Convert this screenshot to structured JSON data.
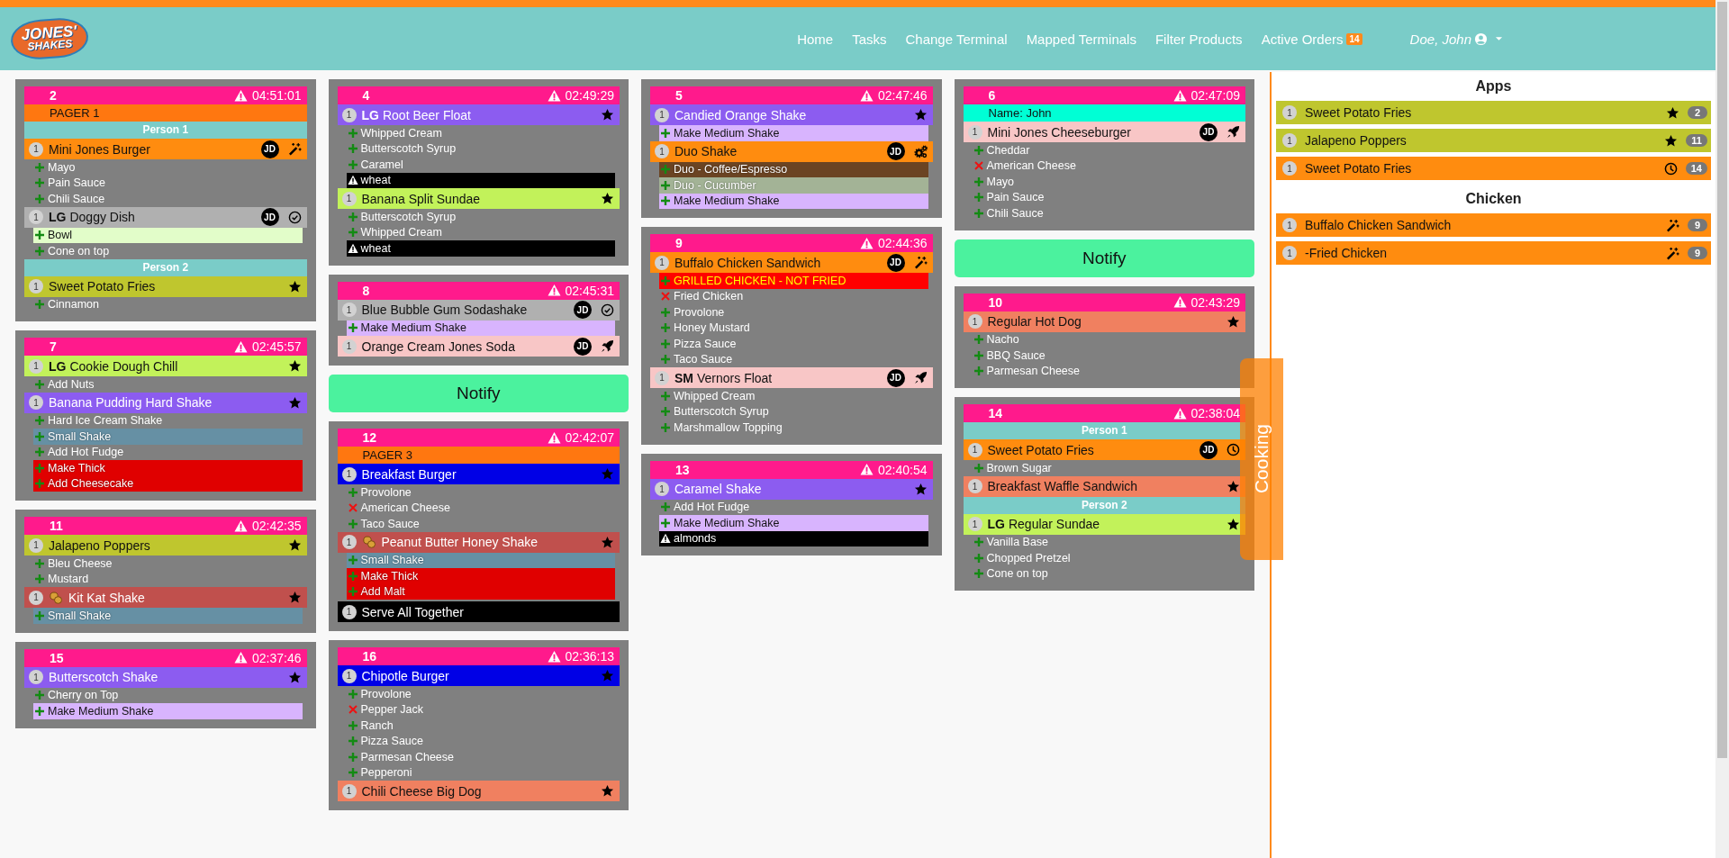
{
  "logo": {
    "line1": "JONES'",
    "line2": "SHAKES"
  },
  "nav": [
    {
      "label": "Home"
    },
    {
      "label": "Tasks"
    },
    {
      "label": "Change Terminal"
    },
    {
      "label": "Mapped Terminals"
    },
    {
      "label": "Filter Products"
    },
    {
      "label": "Active Orders",
      "count": "14"
    }
  ],
  "user": {
    "name": "Doe, John"
  },
  "columns": [
    [
      {
        "kind": "order",
        "number": "2",
        "time": "04:51:01",
        "lines": [
          {
            "kind": "pager",
            "text": "PAGER 1"
          },
          {
            "kind": "person",
            "text": "Person 1"
          },
          {
            "kind": "item",
            "qty": "1",
            "name": "Mini Jones Burger",
            "color": "#ff8c0f",
            "badge": "JD",
            "prep": true
          },
          {
            "kind": "mod",
            "text": "Mayo"
          },
          {
            "kind": "mod",
            "text": "Pain Sauce"
          },
          {
            "kind": "mod",
            "text": "Chili Sauce"
          },
          {
            "kind": "item",
            "qty": "1",
            "size": "LG",
            "name": "Doggy Dish",
            "color": "#b0b0b0",
            "badge": "JD",
            "done": true
          },
          {
            "kind": "mod",
            "text": "Bowl",
            "color": "#e2fdc9"
          },
          {
            "kind": "mod",
            "text": "Cone on top"
          },
          {
            "kind": "person",
            "text": "Person 2"
          },
          {
            "kind": "item",
            "qty": "1",
            "name": "Sweet Potato Fries",
            "color": "#bfc62e",
            "starred": true
          },
          {
            "kind": "mod",
            "text": "Cinnamon"
          }
        ]
      },
      {
        "kind": "order",
        "number": "7",
        "time": "02:45:57",
        "lines": [
          {
            "kind": "item",
            "qty": "1",
            "size": "LG",
            "name": "Cookie Dough Chill",
            "color": "#c2f25a",
            "starred": true
          },
          {
            "kind": "mod",
            "text": "Add Nuts"
          },
          {
            "kind": "item",
            "qty": "1",
            "name": "Banana Pudding Hard Shake",
            "color": "#8c5cf0",
            "light_text": true,
            "starred": true
          },
          {
            "kind": "mod",
            "text": "Hard Ice Cream Shake"
          },
          {
            "kind": "mod",
            "text": "Small Shake",
            "color": "#6690a4",
            "light_text": true
          },
          {
            "kind": "mod",
            "text": "Add Hot Fudge"
          },
          {
            "kind": "mod",
            "text": "Make Thick",
            "color": "#e00000",
            "light_text": true
          },
          {
            "kind": "mod",
            "text": "Add Cheesecake",
            "color": "#e00000",
            "light_text": true
          }
        ]
      },
      {
        "kind": "order",
        "number": "11",
        "time": "02:42:35",
        "lines": [
          {
            "kind": "item",
            "qty": "1",
            "name": "Jalapeno Poppers",
            "color": "#bfc62e",
            "starred": true
          },
          {
            "kind": "mod",
            "text": "Bleu Cheese"
          },
          {
            "kind": "mod",
            "text": "Mustard"
          },
          {
            "kind": "item",
            "qty": "1",
            "name": "Kit Kat Shake",
            "color": "#c0504d",
            "light_text": true,
            "nut": true,
            "starred": true
          },
          {
            "kind": "mod",
            "text": "Small Shake",
            "color": "#6690a4",
            "light_text": true
          }
        ]
      },
      {
        "kind": "order",
        "number": "15",
        "time": "02:37:46",
        "lines": [
          {
            "kind": "item",
            "qty": "1",
            "name": "Butterscotch Shake",
            "color": "#8c5cf0",
            "light_text": true,
            "starred": true
          },
          {
            "kind": "mod",
            "text": "Cherry on Top"
          },
          {
            "kind": "mod",
            "text": "Make Medium Shake",
            "color": "#d8b4fe"
          }
        ]
      }
    ],
    [
      {
        "kind": "order",
        "number": "4",
        "time": "02:49:29",
        "lines": [
          {
            "kind": "item",
            "qty": "1",
            "size": "LG",
            "name": "Root Beer Float",
            "color": "#8c5cf0",
            "light_text": true,
            "starred": true
          },
          {
            "kind": "mod",
            "text": "Whipped Cream"
          },
          {
            "kind": "mod",
            "text": "Butterscotch Syrup"
          },
          {
            "kind": "mod",
            "text": "Caramel"
          },
          {
            "kind": "allergy",
            "text": "wheat"
          },
          {
            "kind": "item",
            "qty": "1",
            "name": "Banana Split Sundae",
            "color": "#c2f25a",
            "starred": true
          },
          {
            "kind": "mod",
            "text": "Butterscotch Syrup"
          },
          {
            "kind": "mod",
            "text": "Whipped Cream"
          },
          {
            "kind": "allergy",
            "text": "wheat"
          }
        ]
      },
      {
        "kind": "order",
        "number": "8",
        "time": "02:45:31",
        "lines": [
          {
            "kind": "item",
            "qty": "1",
            "name": "Blue Bubble Gum Sodashake",
            "color": "#b0b0b0",
            "badge": "JD",
            "done": true
          },
          {
            "kind": "mod",
            "text": "Make Medium Shake",
            "color": "#d8b4fe"
          },
          {
            "kind": "item",
            "qty": "1",
            "name": "Orange Cream Jones Soda",
            "color": "#f8c6c6",
            "badge": "JD",
            "sent": true
          }
        ]
      },
      {
        "kind": "notify",
        "label": "Notify"
      },
      {
        "kind": "order",
        "number": "12",
        "time": "02:42:07",
        "lines": [
          {
            "kind": "pager",
            "text": "PAGER 3"
          },
          {
            "kind": "item",
            "qty": "1",
            "name": "Breakfast Burger",
            "color": "#0000e6",
            "light_text": true,
            "starred": true
          },
          {
            "kind": "mod",
            "text": "Provolone"
          },
          {
            "kind": "mod",
            "text": "American Cheese",
            "removed": true
          },
          {
            "kind": "mod",
            "text": "Taco Sauce"
          },
          {
            "kind": "item",
            "qty": "1",
            "name": "Peanut Butter Honey Shake",
            "color": "#c0504d",
            "light_text": true,
            "nut": true,
            "starred": true
          },
          {
            "kind": "mod",
            "text": "Small Shake",
            "color": "#6690a4",
            "light_text": true
          },
          {
            "kind": "mod",
            "text": "Make Thick",
            "color": "#e00000",
            "light_text": true
          },
          {
            "kind": "mod",
            "text": "Add Malt",
            "color": "#e00000",
            "light_text": true
          },
          {
            "kind": "serve",
            "qty": "1",
            "text": "Serve All Together"
          }
        ]
      },
      {
        "kind": "order",
        "number": "16",
        "time": "02:36:13",
        "lines": [
          {
            "kind": "item",
            "qty": "1",
            "name": "Chipotle Burger",
            "color": "#0000e6",
            "light_text": true,
            "starred": true
          },
          {
            "kind": "mod",
            "text": "Provolone"
          },
          {
            "kind": "mod",
            "text": "Pepper Jack",
            "removed": true
          },
          {
            "kind": "mod",
            "text": "Ranch"
          },
          {
            "kind": "mod",
            "text": "Pizza Sauce"
          },
          {
            "kind": "mod",
            "text": "Parmesan Cheese"
          },
          {
            "kind": "mod",
            "text": "Pepperoni"
          },
          {
            "kind": "item",
            "qty": "1",
            "name": "Chili Cheese Big Dog",
            "color": "#f08060",
            "starred": true
          }
        ]
      }
    ],
    [
      {
        "kind": "order",
        "number": "5",
        "time": "02:47:46",
        "lines": [
          {
            "kind": "item",
            "qty": "1",
            "name": "Candied Orange Shake",
            "color": "#8c5cf0",
            "light_text": true,
            "starred": true
          },
          {
            "kind": "mod",
            "text": "Make Medium Shake",
            "color": "#d8b4fe"
          },
          {
            "kind": "item",
            "qty": "1",
            "name": "Duo Shake",
            "color": "#ff8c0f",
            "badge": "JD",
            "mixing": true
          },
          {
            "kind": "mod",
            "text": "Duo - Coffee/Espresso",
            "color": "#6b4423",
            "light_text": true
          },
          {
            "kind": "mod",
            "text": "Duo - Cucumber",
            "color": "#a3b396",
            "light_text": true
          },
          {
            "kind": "mod",
            "text": "Make Medium Shake",
            "color": "#d8b4fe"
          }
        ]
      },
      {
        "kind": "order",
        "number": "9",
        "time": "02:44:36",
        "lines": [
          {
            "kind": "item",
            "qty": "1",
            "name": "Buffalo Chicken Sandwich",
            "color": "#ff8c0f",
            "badge": "JD",
            "prep": true
          },
          {
            "kind": "mod",
            "text": "GRILLED CHICKEN - NOT FRIED",
            "color": "#ff0000",
            "highlight": true
          },
          {
            "kind": "mod",
            "text": "Fried Chicken",
            "removed": true
          },
          {
            "kind": "mod",
            "text": "Provolone"
          },
          {
            "kind": "mod",
            "text": "Honey Mustard"
          },
          {
            "kind": "mod",
            "text": "Pizza Sauce"
          },
          {
            "kind": "mod",
            "text": "Taco Sauce"
          },
          {
            "kind": "item",
            "qty": "1",
            "size": "SM",
            "name": "Vernors Float",
            "color": "#f8c6c6",
            "badge": "JD",
            "sent": true
          },
          {
            "kind": "mod",
            "text": "Whipped Cream"
          },
          {
            "kind": "mod",
            "text": "Butterscotch Syrup"
          },
          {
            "kind": "mod",
            "text": "Marshmallow Topping"
          }
        ]
      },
      {
        "kind": "order",
        "number": "13",
        "time": "02:40:54",
        "lines": [
          {
            "kind": "item",
            "qty": "1",
            "name": "Caramel Shake",
            "color": "#8c5cf0",
            "light_text": true,
            "starred": true
          },
          {
            "kind": "mod",
            "text": "Add Hot Fudge"
          },
          {
            "kind": "mod",
            "text": "Make Medium Shake",
            "color": "#d8b4fe"
          },
          {
            "kind": "allergy",
            "text": "almonds"
          }
        ]
      }
    ],
    [
      {
        "kind": "order",
        "number": "6",
        "time": "02:47:09",
        "lines": [
          {
            "kind": "name",
            "text": "Name: John"
          },
          {
            "kind": "item",
            "qty": "1",
            "name": "Mini Jones Cheeseburger",
            "color": "#f8c6c6",
            "badge": "JD",
            "sent": true
          },
          {
            "kind": "mod",
            "text": "Cheddar"
          },
          {
            "kind": "mod",
            "text": "American Cheese",
            "removed": true
          },
          {
            "kind": "mod",
            "text": "Mayo"
          },
          {
            "kind": "mod",
            "text": "Pain Sauce"
          },
          {
            "kind": "mod",
            "text": "Chili Sauce"
          }
        ]
      },
      {
        "kind": "notify",
        "label": "Notify"
      },
      {
        "kind": "order",
        "number": "10",
        "time": "02:43:29",
        "lines": [
          {
            "kind": "item",
            "qty": "1",
            "name": "Regular Hot Dog",
            "color": "#f08060",
            "starred": true
          },
          {
            "kind": "mod",
            "text": "Nacho"
          },
          {
            "kind": "mod",
            "text": "BBQ Sauce"
          },
          {
            "kind": "mod",
            "text": "Parmesan Cheese"
          }
        ]
      },
      {
        "kind": "order",
        "number": "14",
        "time": "02:38:04",
        "lines": [
          {
            "kind": "person",
            "text": "Person 1"
          },
          {
            "kind": "item",
            "qty": "1",
            "name": "Sweet Potato Fries",
            "color": "#ff8c0f",
            "badge": "JD",
            "waiting": true
          },
          {
            "kind": "mod",
            "text": "Brown Sugar"
          },
          {
            "kind": "item",
            "qty": "1",
            "name": "Breakfast Waffle Sandwich",
            "color": "#f08060",
            "starred": true
          },
          {
            "kind": "person",
            "text": "Person 2"
          },
          {
            "kind": "item",
            "qty": "1",
            "size": "LG",
            "name": "Regular Sundae",
            "color": "#c2f25a",
            "starred": true
          },
          {
            "kind": "mod",
            "text": "Vanilla Base"
          },
          {
            "kind": "mod",
            "text": "Chopped Pretzel"
          },
          {
            "kind": "mod",
            "text": "Cone on top"
          }
        ]
      }
    ]
  ],
  "cooking_tab": {
    "label": "Cooking"
  },
  "sidebar": {
    "sections": [
      {
        "title": "Apps",
        "items": [
          {
            "qty": "1",
            "name": "Sweet Potato Fries",
            "color": "#bfc62e",
            "starred": true,
            "order": "2"
          },
          {
            "qty": "1",
            "name": "Jalapeno Poppers",
            "color": "#bfc62e",
            "starred": true,
            "order": "11"
          },
          {
            "qty": "1",
            "name": "Sweet Potato Fries",
            "color": "#ff8c0f",
            "waiting": true,
            "order": "14"
          }
        ]
      },
      {
        "title": "Chicken",
        "items": [
          {
            "qty": "1",
            "name": "Buffalo Chicken Sandwich",
            "color": "#ff8c0f",
            "prep": true,
            "order": "9"
          },
          {
            "qty": "1",
            "name": "-Fried Chicken",
            "color": "#ff8c0f",
            "prep": true,
            "order": "9"
          }
        ]
      }
    ]
  }
}
